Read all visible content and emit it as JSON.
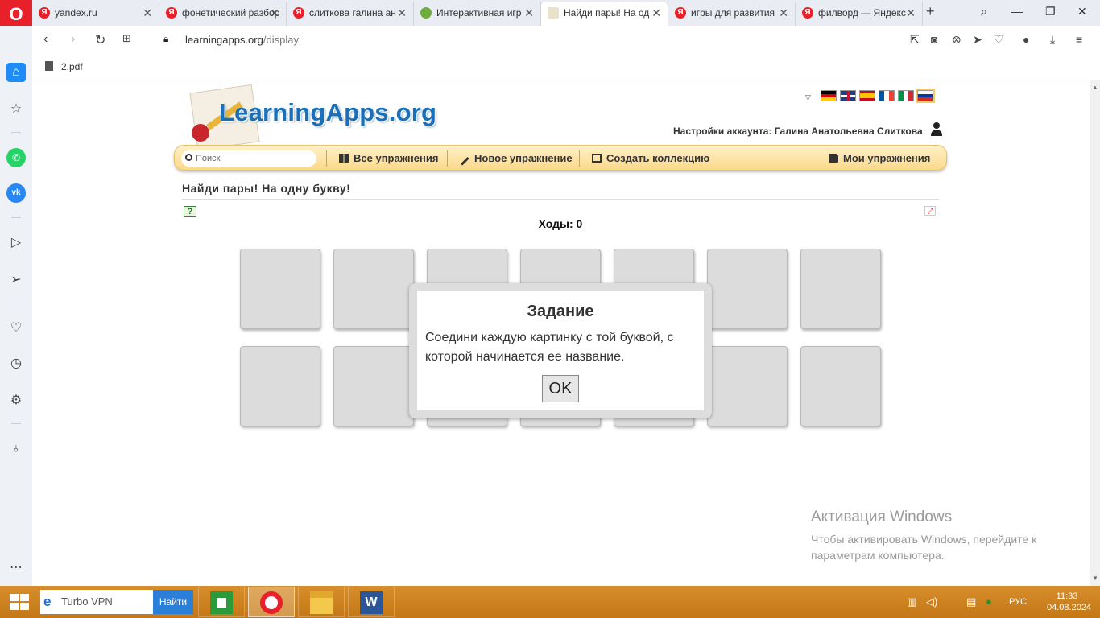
{
  "browser": {
    "tabs": [
      {
        "title": "yandex.ru",
        "favicon": "Я",
        "active": false
      },
      {
        "title": "фонетический разбор",
        "favicon": "Я",
        "active": false
      },
      {
        "title": "слиткова галина ан",
        "favicon": "Я",
        "active": false
      },
      {
        "title": "Интерактивная игр",
        "favicon": "",
        "active": false
      },
      {
        "title": "Найди пары! На од",
        "favicon": "",
        "active": true
      },
      {
        "title": "игры для развития",
        "favicon": "Я",
        "active": false
      },
      {
        "title": "филворд — Яндекс",
        "favicon": "Я",
        "active": false
      }
    ],
    "url_host": "learningapps.org",
    "url_path": "/display",
    "bookmark": "2.pdf"
  },
  "site": {
    "logo_text": "LearningApps.org",
    "account_label": "Настройки аккаунта: Галина Анатольевна Слиткова",
    "search_placeholder": "Поиск",
    "menu": {
      "all": "Все упражнения",
      "new": "Новое упражнение",
      "collection": "Создать коллекцию",
      "mine": "Мои упражнения"
    }
  },
  "exercise": {
    "title": "Найди пары! На одну букву!",
    "moves_label": "Ходы: 0",
    "card_rows": 2,
    "cards_per_row": 7
  },
  "modal": {
    "title": "Задание",
    "text": "Соедини каждую картинку с той буквой, с которой начинается ее название.",
    "ok": "OK"
  },
  "watermark": {
    "title": "Активация Windows",
    "text": "Чтобы активировать Windows, перейдите к параметрам компьютера."
  },
  "taskbar": {
    "search_text": "Turbo VPN",
    "find_button": "Найти",
    "language": "РУС",
    "time": "11:33",
    "date": "04.08.2024"
  }
}
